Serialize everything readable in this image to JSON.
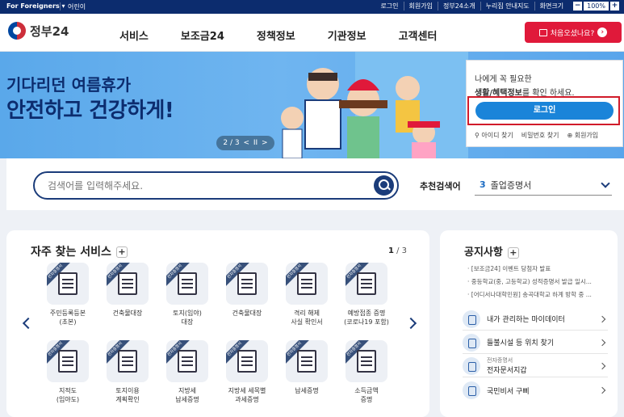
{
  "topbar": {
    "foreigners": "For Foreigners ▾",
    "kids": "어린이",
    "links": [
      "로그인",
      "회원가입",
      "정부24소개",
      "누리집 안내지도",
      "화면크기"
    ],
    "zoom_minus": "−",
    "zoom_value": "100%",
    "zoom_plus": "+"
  },
  "header": {
    "logo": "정부24",
    "nav": [
      "서비스",
      "보조금24",
      "정책정보",
      "기관정보",
      "고객센터"
    ],
    "first_visit": "처음오셨나요?",
    "first_visit_arrow": "›"
  },
  "hero": {
    "line1": "기다리던 여름휴가",
    "line2": "안전하고 건강하게!",
    "pager": {
      "current": "2 / 3",
      "prev": "<",
      "pause": "II",
      "next": ">"
    }
  },
  "login": {
    "line1": "나에게 꼭 필요한",
    "line2_bold": "생활/혜택정보",
    "line2_rest": "를 확인 하세요.",
    "button": "로그인",
    "links": [
      "아이디 찾기",
      "비밀번호 찾기",
      "회원가입"
    ]
  },
  "search": {
    "placeholder": "검색어를 입력해주세요.",
    "recommend_label": "추천검색어",
    "recommend_num": "3",
    "recommend_value": "졸업증명서"
  },
  "services": {
    "title": "자주 찾는 서비스",
    "plus": "+",
    "page_current": "1",
    "page_total": " / 3",
    "ribbon": "전자증명서",
    "items": [
      "주민등록등본\n(초본)",
      "건축물대장",
      "토지(임야)\n대장",
      "건축물대장",
      "격리 해제\n사실 확인서",
      "예방접종 증명\n(코로나19 포함)",
      "지적도\n(임야도)",
      "토지이용\n계획확인",
      "지방세\n납세증명",
      "지방세 세목별\n과세증명",
      "납세증명",
      "소득금액\n증명"
    ]
  },
  "notice": {
    "title": "공지사항",
    "plus": "+",
    "items": [
      "[보조금24] 이벤트 당첨자 발표",
      "중등학교(중, 고등학교) 성적증명서 발급 일시...",
      "[어디서나대학민원] 송곡대학교 하계 방학 중 ..."
    ],
    "quick": [
      {
        "label": "내가 관리하는 마이데이터",
        "sub": ""
      },
      {
        "label": "들불시설 등 위치 찾기",
        "sub": ""
      },
      {
        "label": "전자문서지갑",
        "sub": "전자증명서"
      },
      {
        "label": "국민비서 구삐",
        "sub": ""
      }
    ]
  },
  "colors": {
    "navy": "#0c2c6e",
    "accent_red": "#e0193a",
    "login_blue": "#1a84d9"
  }
}
